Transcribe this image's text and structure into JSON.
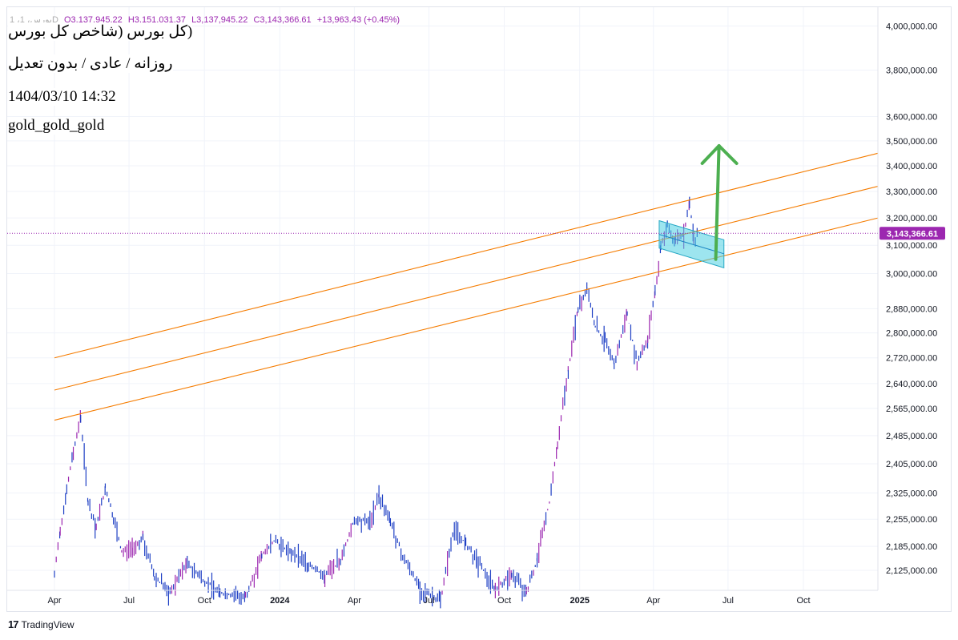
{
  "header": {
    "symbol": "1 ،بورس، 1D",
    "open": "O3,137,945.22",
    "high": "H3,151,031.37",
    "low": "L3,137,945.22",
    "close": "C3,143,366.61",
    "change": "+13,963.43 (+0.45%)"
  },
  "info_box": {
    "title": "(کل بورس (شاخص کل بورس",
    "subtitle": "روزانه / عادی / بدون تعدیل",
    "datetime": "1404/03/10 14:32",
    "watermark": "gold_gold_gold"
  },
  "footer": {
    "brand": "TradingView"
  },
  "colors": {
    "candle": "#1e3fc4",
    "candle_up": "#9c27b0",
    "trend": "#f57c00",
    "arrow": "#4caf50",
    "channel": "#4dd0e1",
    "price_label": "#9c27b0"
  },
  "chart_data": {
    "type": "line",
    "y_scale": "log",
    "ylim": [
      2080000,
      4050000
    ],
    "y_ticks": [
      "4,000,000.00",
      "3,800,000.00",
      "3,600,000.00",
      "3,500,000.00",
      "3,400,000.00",
      "3,300,000.00",
      "3,200,000.00",
      "3,100,000.00",
      "3,000,000.00",
      "2,880,000.00",
      "2,800,000.00",
      "2,720,000.00",
      "2,640,000.00",
      "2,565,000.00",
      "2,485,000.00",
      "2,405,000.00",
      "2,325,000.00",
      "2,255,000.00",
      "2,185,000.00",
      "2,125,000.00"
    ],
    "y_tick_values": [
      4000000,
      3800000,
      3600000,
      3500000,
      3400000,
      3300000,
      3200000,
      3100000,
      3000000,
      2880000,
      2800000,
      2720000,
      2640000,
      2565000,
      2485000,
      2405000,
      2325000,
      2255000,
      2185000,
      2125000
    ],
    "x_ticks": [
      {
        "label": "Apr",
        "date": "2023-04-01",
        "bold": false
      },
      {
        "label": "Jul",
        "date": "2023-07-01",
        "bold": false
      },
      {
        "label": "Oct",
        "date": "2023-10-01",
        "bold": false
      },
      {
        "label": "2024",
        "date": "2024-01-01",
        "bold": true
      },
      {
        "label": "Apr",
        "date": "2024-04-01",
        "bold": false
      },
      {
        "label": "Jul",
        "date": "2024-07-01",
        "bold": false
      },
      {
        "label": "Oct",
        "date": "2024-10-01",
        "bold": false
      },
      {
        "label": "2025",
        "date": "2025-01-01",
        "bold": true
      },
      {
        "label": "Apr",
        "date": "2025-04-01",
        "bold": false
      },
      {
        "label": "Jul",
        "date": "2025-07-01",
        "bold": false
      },
      {
        "label": "Oct",
        "date": "2025-10-01",
        "bold": false
      }
    ],
    "last_price": 3143366.61,
    "last_price_label": "3,143,366.61",
    "price_series": [
      {
        "date": "2023-04-01",
        "value": 2110000
      },
      {
        "date": "2023-04-08",
        "value": 2230000
      },
      {
        "date": "2023-04-16",
        "value": 2330000
      },
      {
        "date": "2023-04-24",
        "value": 2440000
      },
      {
        "date": "2023-05-03",
        "value": 2540000
      },
      {
        "date": "2023-05-12",
        "value": 2300000
      },
      {
        "date": "2023-05-22",
        "value": 2230000
      },
      {
        "date": "2023-06-02",
        "value": 2340000
      },
      {
        "date": "2023-06-12",
        "value": 2260000
      },
      {
        "date": "2023-06-22",
        "value": 2170000
      },
      {
        "date": "2023-07-05",
        "value": 2180000
      },
      {
        "date": "2023-07-18",
        "value": 2205000
      },
      {
        "date": "2023-08-01",
        "value": 2110000
      },
      {
        "date": "2023-08-20",
        "value": 2070000
      },
      {
        "date": "2023-09-10",
        "value": 2140000
      },
      {
        "date": "2023-09-25",
        "value": 2110000
      },
      {
        "date": "2023-10-20",
        "value": 2070000
      },
      {
        "date": "2023-11-20",
        "value": 2060000
      },
      {
        "date": "2023-12-10",
        "value": 2160000
      },
      {
        "date": "2023-12-25",
        "value": 2200000
      },
      {
        "date": "2024-01-15",
        "value": 2170000
      },
      {
        "date": "2024-02-05",
        "value": 2140000
      },
      {
        "date": "2024-02-25",
        "value": 2110000
      },
      {
        "date": "2024-03-15",
        "value": 2150000
      },
      {
        "date": "2024-04-01",
        "value": 2255000
      },
      {
        "date": "2024-04-20",
        "value": 2250000
      },
      {
        "date": "2024-05-01",
        "value": 2320000
      },
      {
        "date": "2024-05-15",
        "value": 2250000
      },
      {
        "date": "2024-05-30",
        "value": 2160000
      },
      {
        "date": "2024-06-20",
        "value": 2080000
      },
      {
        "date": "2024-07-15",
        "value": 2050000
      },
      {
        "date": "2024-08-01",
        "value": 2230000
      },
      {
        "date": "2024-08-15",
        "value": 2190000
      },
      {
        "date": "2024-08-28",
        "value": 2150000
      },
      {
        "date": "2024-09-20",
        "value": 2080000
      },
      {
        "date": "2024-10-10",
        "value": 2115000
      },
      {
        "date": "2024-10-28",
        "value": 2070000
      },
      {
        "date": "2024-11-10",
        "value": 2150000
      },
      {
        "date": "2024-11-25",
        "value": 2300000
      },
      {
        "date": "2024-12-05",
        "value": 2460000
      },
      {
        "date": "2024-12-18",
        "value": 2680000
      },
      {
        "date": "2024-12-30",
        "value": 2880000
      },
      {
        "date": "2025-01-10",
        "value": 2950000
      },
      {
        "date": "2025-01-20",
        "value": 2820000
      },
      {
        "date": "2025-02-01",
        "value": 2770000
      },
      {
        "date": "2025-02-12",
        "value": 2700000
      },
      {
        "date": "2025-02-28",
        "value": 2860000
      },
      {
        "date": "2025-03-12",
        "value": 2700000
      },
      {
        "date": "2025-03-25",
        "value": 2780000
      },
      {
        "date": "2025-04-03",
        "value": 2930000
      },
      {
        "date": "2025-04-10",
        "value": 3100000
      },
      {
        "date": "2025-04-18",
        "value": 3170000
      },
      {
        "date": "2025-04-28",
        "value": 3110000
      },
      {
        "date": "2025-05-08",
        "value": 3140000
      },
      {
        "date": "2025-05-15",
        "value": 3270000
      },
      {
        "date": "2025-05-20",
        "value": 3120000
      },
      {
        "date": "2025-05-26",
        "value": 3143366
      }
    ],
    "trend_lines": [
      {
        "from": {
          "date": "2023-04-01",
          "value": 2720000
        },
        "to": {
          "date": "2025-12-31",
          "value": 3450000
        }
      },
      {
        "from": {
          "date": "2023-04-01",
          "value": 2620000
        },
        "to": {
          "date": "2025-12-31",
          "value": 3320000
        }
      },
      {
        "from": {
          "date": "2023-04-01",
          "value": 2530000
        },
        "to": {
          "date": "2025-12-31",
          "value": 3200000
        }
      }
    ],
    "channel": {
      "upper": {
        "from": {
          "date": "2025-04-08",
          "value": 3190000
        },
        "to": {
          "date": "2025-06-26",
          "value": 3120000
        }
      },
      "lower": {
        "from": {
          "date": "2025-04-08",
          "value": 3090000
        },
        "to": {
          "date": "2025-06-26",
          "value": 3020000
        }
      }
    },
    "arrow": {
      "from": {
        "date": "2025-06-16",
        "value": 3050000
      },
      "to": {
        "date": "2025-06-20",
        "value": 3480000
      }
    }
  }
}
